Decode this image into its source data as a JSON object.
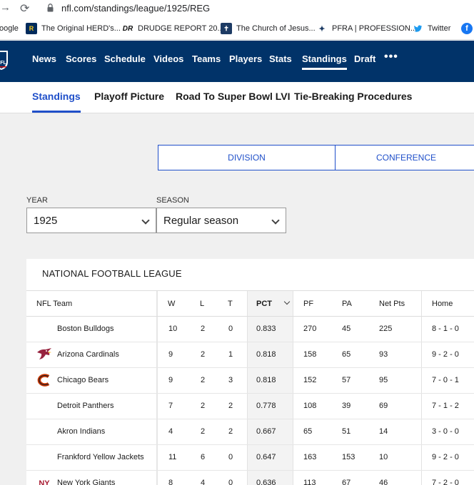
{
  "browser": {
    "url": "nfl.com/standings/league/1925/REG",
    "bookmarks": [
      {
        "label": "oogle",
        "icon": "google-icon"
      },
      {
        "label": "The Original HERD's...",
        "icon": "rams-icon"
      },
      {
        "label": "DRUDGE REPORT 20...",
        "icon": "drudge-icon"
      },
      {
        "label": "The Church of Jesus...",
        "icon": "church-icon"
      },
      {
        "label": "PFRA | PROFESSION...",
        "icon": "pfra-icon"
      },
      {
        "label": "Twitter",
        "icon": "twitter-icon"
      }
    ]
  },
  "nav": {
    "items": [
      "News",
      "Scores",
      "Schedule",
      "Videos",
      "Teams",
      "Players",
      "Stats",
      "Standings",
      "Draft"
    ],
    "active": "Standings",
    "more": "•••"
  },
  "subnav": {
    "items": [
      "Standings",
      "Playoff Picture",
      "Road To Super Bowl LVI",
      "Tie-Breaking Procedures"
    ],
    "active": "Standings"
  },
  "toggle": {
    "division": "DIVISION",
    "conference": "CONFERENCE"
  },
  "filters": {
    "year_label": "YEAR",
    "year_value": "1925",
    "season_label": "SEASON",
    "season_value": "Regular season"
  },
  "table": {
    "title": "NATIONAL FOOTBALL LEAGUE",
    "headers": [
      "NFL Team",
      "W",
      "L",
      "T",
      "PCT",
      "PF",
      "PA",
      "Net Pts",
      "Home"
    ],
    "rows": [
      {
        "team": "Boston Bulldogs",
        "w": "10",
        "l": "2",
        "t": "0",
        "pct": "0.833",
        "pf": "270",
        "pa": "45",
        "net": "225",
        "home": "8 - 1 - 0",
        "logo": "none"
      },
      {
        "team": "Arizona Cardinals",
        "w": "9",
        "l": "2",
        "t": "1",
        "pct": "0.818",
        "pf": "158",
        "pa": "65",
        "net": "93",
        "home": "9 - 2 - 0",
        "logo": "cardinals-logo"
      },
      {
        "team": "Chicago Bears",
        "w": "9",
        "l": "2",
        "t": "3",
        "pct": "0.818",
        "pf": "152",
        "pa": "57",
        "net": "95",
        "home": "7 - 0 - 1",
        "logo": "bears-logo"
      },
      {
        "team": "Detroit Panthers",
        "w": "7",
        "l": "2",
        "t": "2",
        "pct": "0.778",
        "pf": "108",
        "pa": "39",
        "net": "69",
        "home": "7 - 1 - 2",
        "logo": "none"
      },
      {
        "team": "Akron Indians",
        "w": "4",
        "l": "2",
        "t": "2",
        "pct": "0.667",
        "pf": "65",
        "pa": "51",
        "net": "14",
        "home": "3 - 0 - 0",
        "logo": "none"
      },
      {
        "team": "Frankford Yellow Jackets",
        "w": "11",
        "l": "6",
        "t": "0",
        "pct": "0.647",
        "pf": "163",
        "pa": "153",
        "net": "10",
        "home": "9 - 2 - 0",
        "logo": "none"
      },
      {
        "team": "New York Giants",
        "w": "8",
        "l": "4",
        "t": "0",
        "pct": "0.636",
        "pf": "113",
        "pa": "67",
        "net": "46",
        "home": "7 - 2 - 0",
        "logo": "giants-logo"
      }
    ]
  },
  "colors": {
    "nfl_navy": "#013369",
    "link_blue": "#1f4fc9",
    "cardinals_red": "#97233f",
    "bears_orange": "#c83803",
    "giants_red": "#a71930"
  }
}
